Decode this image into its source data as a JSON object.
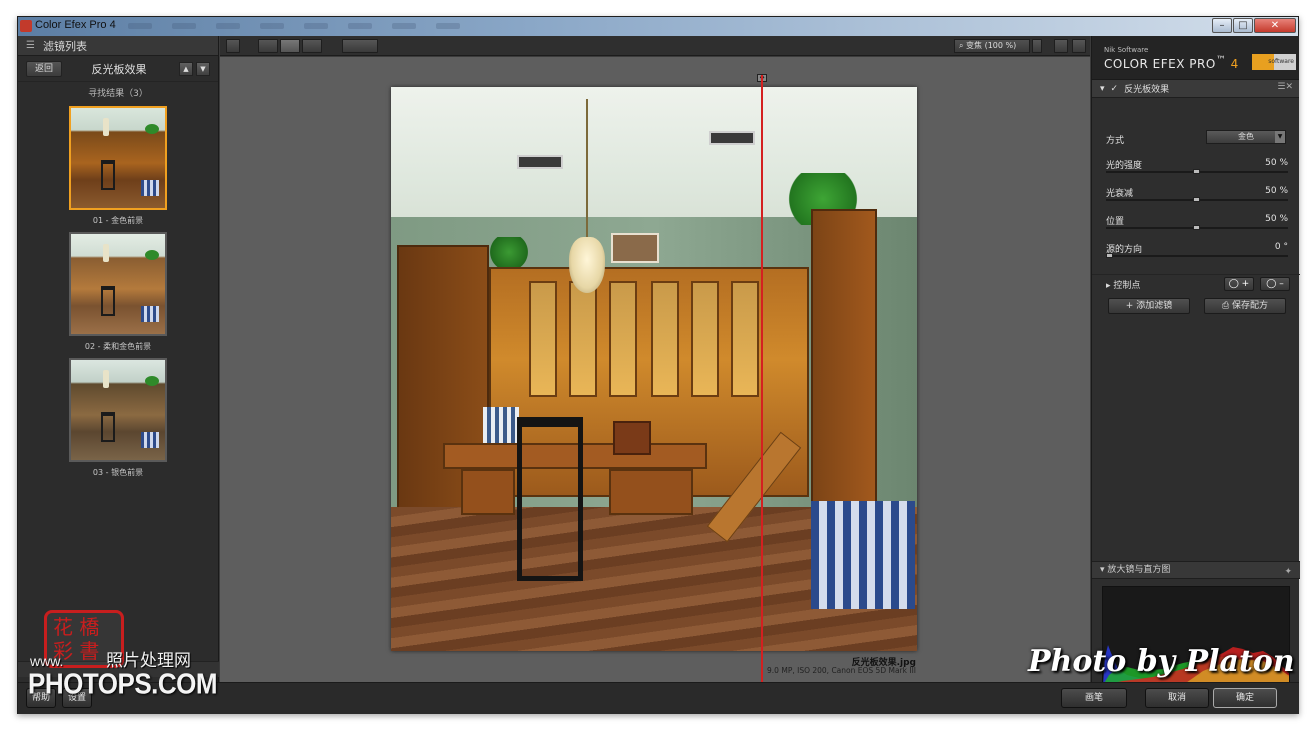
{
  "window": {
    "title": "Color Efex Pro 4",
    "minimize": "–",
    "maximize": "□",
    "close": "✕"
  },
  "left_panel": {
    "header": "滤镜列表",
    "header_icon": "list-icon",
    "back_label": "返回",
    "filter_name": "反光板效果",
    "results_label": "寻找结果（3）",
    "presets": [
      {
        "label": "01 - 金色前景"
      },
      {
        "label": "02 - 柔和金色前景"
      },
      {
        "label": "03 - 银色前景"
      }
    ],
    "bottom_buttons": [
      "帮助",
      "设置"
    ]
  },
  "toolbar": {
    "zoom_label": "变焦 (100 %)"
  },
  "image": {
    "file_name": "反光板效果.jpg",
    "meta": "9.0 MP, ISO 200, Canon EOS 5D Mark III"
  },
  "right_panel": {
    "brand_small": "Nik Software",
    "brand_big": "COLOR EFEX PRO",
    "brand_tm": "™",
    "brand_num": "4",
    "nik_logo": "software",
    "filter_title": "反光板效果",
    "method_label": "方式",
    "method_value": "金色",
    "params": [
      {
        "label": "光的强度",
        "value": "50 %",
        "level": 0.5
      },
      {
        "label": "光衰减",
        "value": "50 %",
        "level": 0.5
      },
      {
        "label": "位置",
        "value": "50 %",
        "level": 0.5
      },
      {
        "label": "源的方向",
        "value": "0 °",
        "level": 0.0
      }
    ],
    "control_points_label": "控制点",
    "add_cp_plus": "◯ +",
    "add_cp_minus": "◯ –",
    "add_filter": "+ 添加滤镜",
    "save_recipe": "保存配方",
    "loupe_title": "放大镜与直方图"
  },
  "actions": {
    "brush": "画笔",
    "cancel": "取消",
    "ok": "确定"
  },
  "watermarks": {
    "seal_text": "花橋彩書",
    "www": "www.",
    "cn_site": "照片处理网",
    "photops": "PHOTOPS.COM",
    "platon": "Photo by Platon"
  },
  "colors": {
    "accent": "#f0a020",
    "split_line": "#d42020",
    "panel_bg": "#2e2e2e",
    "canvas_bg": "#5e5e5e"
  }
}
